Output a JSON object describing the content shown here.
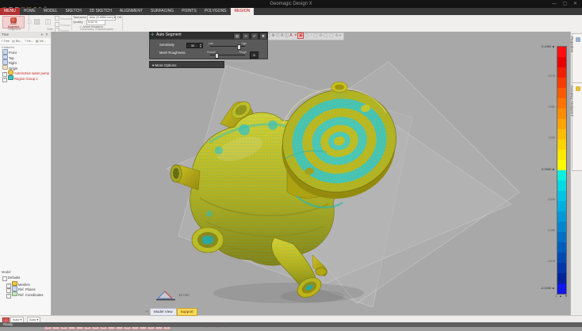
{
  "window": {
    "title": "Geomagic Design X",
    "controls": "—  ▢  ✕"
  },
  "titlebar": {
    "qat_icons": [
      {
        "n": "new-file-icon",
        "g": "▤",
        "c": "#c8a04a"
      },
      {
        "n": "open-file-icon",
        "g": "▥",
        "c": "#c9c9c9"
      },
      {
        "n": "save-icon",
        "g": "▦",
        "c": "#c9c9c9"
      },
      {
        "n": "import-icon",
        "g": "◳",
        "c": "#d06a4a"
      },
      {
        "n": "export-icon",
        "g": "◱",
        "c": "#b9a94a"
      },
      {
        "n": "undo-icon",
        "g": "↶",
        "c": "#c9b95a"
      },
      {
        "n": "redo-icon",
        "g": "↷",
        "c": "#9a9a9a"
      },
      {
        "n": "help-icon",
        "g": "?",
        "c": "#9a9a9a"
      }
    ]
  },
  "tabs": [
    {
      "label": "MENU"
    },
    {
      "label": "HOME"
    },
    {
      "label": "MODEL"
    },
    {
      "label": "SKETCH"
    },
    {
      "label": "3D SKETCH"
    },
    {
      "label": "ALIGNMENT"
    },
    {
      "label": "SURFACING"
    },
    {
      "label": "POINTS"
    },
    {
      "label": "POLYGONS"
    },
    {
      "label": "REGION"
    }
  ],
  "ribbon": {
    "auto_segment_line1": "Auto",
    "auto_segment_line2": "Segment",
    "group_labels": [
      "Segment",
      "Edit",
      "Geometry Classification"
    ],
    "edit_big_icons": [
      {
        "n": "split-region-icon",
        "g": "▧",
        "c": "#b9b7b3"
      },
      {
        "n": "merge-region-icon",
        "g": "◫",
        "c": "#b9b7b3"
      }
    ],
    "edit_small_buttons": [
      "Separate",
      "Enlarge",
      "Shrink"
    ],
    "tolerance_label": "Tolerance",
    "tolerance_value": "Auto (0.0554 mm)",
    "tolerance_ok": "OK",
    "quality_label": "Quality",
    "quality_value": "5.00 %",
    "allow_invasion": "Allow Invasion",
    "checkmark": "✓"
  },
  "left_panel": {
    "title": "Tree",
    "head_buttons": "▾ ✕",
    "toolbar": [
      {
        "n": "tree-filter-button",
        "g": "≡",
        "label": "Tree"
      },
      {
        "n": "body-filter-button",
        "g": "▤",
        "label": "Blo..."
      },
      {
        "n": "help-filter-button",
        "g": "?",
        "label": "He..."
      },
      {
        "n": "view-filter-button",
        "g": "▦",
        "label": "Vie..."
      }
    ],
    "section_label": "Features",
    "features": [
      {
        "label": "Front"
      },
      {
        "label": "Top"
      },
      {
        "label": "Right"
      },
      {
        "label": "Origin"
      },
      {
        "label": "Automotive water pump"
      },
      {
        "label": "Region Group 1"
      }
    ],
    "model_section": {
      "title": "Model",
      "items": [
        "Defaults",
        "Meshes",
        "Ref. Planes",
        "Ref. Coordinates"
      ]
    }
  },
  "dialog": {
    "title": "Auto Segment",
    "header_buttons": [
      {
        "n": "dialog-lock-button",
        "g": "▤"
      },
      {
        "n": "dialog-preview-button",
        "g": "⊙"
      },
      {
        "n": "dialog-ok-button",
        "g": "✔"
      },
      {
        "n": "dialog-cancel-button",
        "g": "✖"
      }
    ],
    "sensitivity_label": "Sensitivity",
    "sensitivity_value": "30",
    "slider1_min": "Low",
    "slider1_max": "High",
    "roughness_label": "Mesh Roughness",
    "slider2_min": "Smooth",
    "slider2_max": "Rough",
    "more_options_label": "▾  More Options"
  },
  "viewport": {
    "toolbar_icons": [
      {
        "n": "exit-mode-icon",
        "g": "⊗",
        "c": "#d8721e"
      },
      {
        "n": "plane-display-icon",
        "g": "▱",
        "c": "#787878"
      },
      {
        "n": "mesh-display-icon",
        "g": "▢",
        "c": "#787878"
      },
      {
        "n": "target-icon",
        "g": "⊕",
        "c": "#787878"
      },
      {
        "n": "hex-region-icon",
        "g": "⬡",
        "c": "#787878"
      },
      {
        "n": "label-a-icon",
        "g": "A",
        "c": "#787878"
      },
      {
        "n": "mirror-icon",
        "g": "◫",
        "c": "#787878"
      },
      {
        "n": "annotation-icon",
        "g": "A",
        "c": "#c03424"
      },
      {
        "n": "filter-icon",
        "g": "▼",
        "c": "#909090"
      },
      {
        "n": "selected-select-tool-icon",
        "g": "▣",
        "c": "#c03424",
        "hl": true
      },
      {
        "n": "view-circle-icon",
        "g": "◯",
        "c": "#9a9a9a"
      },
      {
        "n": "view-circle2-icon",
        "g": "◔",
        "c": "#9a9a9a"
      },
      {
        "n": "view-circle3-icon",
        "g": "◯",
        "c": "#9a9a9a"
      },
      {
        "n": "view-grid-icon",
        "g": "⊞",
        "c": "#9a9a9a"
      },
      {
        "n": "view-circle4-icon",
        "g": "◯",
        "c": "#9a9a9a"
      },
      {
        "n": "view-circle5-icon",
        "g": "◯",
        "c": "#9a9a9a"
      },
      {
        "n": "view-plus-icon",
        "g": "⊕",
        "c": "#9a9a9a"
      },
      {
        "n": "view-more-icon",
        "g": "▸",
        "c": "#9a9a9a"
      }
    ],
    "scale_label": "10 mm",
    "view_tabs": {
      "close": "×",
      "tab1": "Model View",
      "tab2": "Support"
    }
  },
  "right_panel": {
    "tab1": "Properties",
    "tab2": "Accuracy Analyzer™",
    "legend": {
      "max": "0.1000",
      "mid": "0.0000",
      "min": "-0.1000",
      "arrow": "►",
      "ticks": [
        "0.075",
        "0.050",
        "0.025",
        "-0.025",
        "-0.050",
        "-0.075"
      ],
      "controls": "1 ▲ ▼",
      "colors": [
        "#ff0f0f",
        "#e60000",
        "#ee2000",
        "#f43d00",
        "#f95a00",
        "#fc7300",
        "#fe8c00",
        "#ffa400",
        "#ffbc00",
        "#ffd300",
        "#ffe900",
        "#fdfb02",
        "#0cefdf",
        "#00d9e2",
        "#00c3e5",
        "#00aee0",
        "#0099d8",
        "#0085cf",
        "#0071c5",
        "#005dbb",
        "#0049b1",
        "#0036a7",
        "#00239d",
        "#1216e8"
      ]
    }
  },
  "statusbar": {
    "dropdown1": "Auto ▾",
    "dropdown2": "Auto ▾",
    "icons": [
      {
        "n": "sb-folder-icon",
        "g": "▤"
      },
      {
        "n": "sb-globe-icon",
        "g": "◍"
      },
      {
        "n": "sb-grid-icon",
        "g": "▦"
      },
      {
        "n": "sb-pencil1-icon",
        "g": "✎"
      },
      {
        "n": "sb-pencil2-icon",
        "g": "✎"
      },
      {
        "n": "sb-region-icon",
        "g": "▧"
      },
      {
        "n": "sb-snap-icon",
        "g": "◳"
      },
      {
        "n": "sb-layers-icon",
        "g": "▥"
      },
      {
        "n": "sb-add-icon",
        "g": "⊞"
      },
      {
        "n": "sb-measure-icon",
        "g": "◔"
      },
      {
        "n": "sb-box-icon",
        "g": "▣"
      },
      {
        "n": "sb-diamond-icon",
        "g": "◇"
      },
      {
        "n": "sb-circ-icon",
        "g": "○"
      },
      {
        "n": "sb-target-icon",
        "g": "◎"
      },
      {
        "n": "sb-rect-icon",
        "g": "▭"
      },
      {
        "n": "sb-doc-icon",
        "g": "▯"
      }
    ],
    "icons2": [
      {
        "n": "sb-view-icon",
        "g": "◑",
        "c": "#7a7a7a"
      },
      {
        "n": "sb-cam-icon",
        "g": "▢",
        "c": "#7a7a7a"
      },
      {
        "n": "sb-sun-icon",
        "g": "◉",
        "c": "#b89a40"
      },
      {
        "n": "sb-cube-icon",
        "g": "▣",
        "c": "#7a7a7a"
      },
      {
        "n": "sb-light-icon",
        "g": "◇",
        "c": "#7a7a7a"
      }
    ],
    "ready": "Ready"
  }
}
